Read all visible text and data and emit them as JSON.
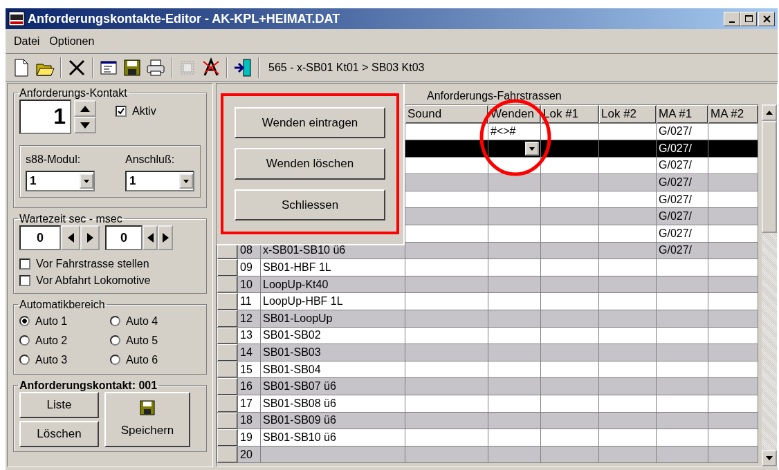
{
  "window": {
    "title": "Anforderungskontakte-Editor - AK-KPL+HEIMAT.DAT"
  },
  "menu": [
    "Datei",
    "Optionen"
  ],
  "toolbar": {
    "info": "565 - x-SB01 Kt01 > SB03 Kt03"
  },
  "contact": {
    "title": "Anforderungs-Kontakt",
    "value": "1",
    "aktiv": {
      "label": "Aktiv",
      "checked": true
    },
    "s88_label": "s88-Modul:",
    "s88_value": "1",
    "anschluss_label": "Anschluß:",
    "anschluss_value": "1"
  },
  "wartezeit": {
    "title": "Wartezeit  sec - msec",
    "sec": "0",
    "msec": "0"
  },
  "options": [
    {
      "label": "Vor Fahrstrasse stellen",
      "checked": false
    },
    {
      "label": "Vor Abfahrt Lokomotive",
      "checked": false
    }
  ],
  "automatik": {
    "title": "Automatikbereich",
    "radios": [
      {
        "label": "Auto 1",
        "selected": true
      },
      {
        "label": "Auto 2",
        "selected": false
      },
      {
        "label": "Auto 3",
        "selected": false
      },
      {
        "label": "Auto 4",
        "selected": false
      },
      {
        "label": "Auto 5",
        "selected": false
      },
      {
        "label": "Auto 6",
        "selected": false
      }
    ]
  },
  "footer_group": {
    "title": "Anforderungskontakt: 001",
    "buttons": [
      "Liste",
      "Löschen"
    ],
    "save_button": "Speichern"
  },
  "popup": {
    "buttons": [
      "Wenden  eintragen",
      "Wenden  löschen",
      "Schliessen"
    ]
  },
  "grid": {
    "title": "Anforderungs-Fahrstrassen",
    "columns": [
      "Sound",
      "Wenden",
      "Lok #1",
      "Lok #2",
      "MA #1",
      "MA #2"
    ],
    "rows": [
      {
        "wenden": "#<>#",
        "ma_1": "G/027/",
        "selected": false,
        "editing": false
      },
      {
        "ma_1": "G/027/",
        "selected": true,
        "editing": true
      },
      {
        "ma_1": "G/027/",
        "selected": false,
        "editing": false
      },
      {
        "ma_1": "G/027/",
        "selected": false,
        "editing": false
      },
      {
        "ma_1": "G/027/",
        "selected": false,
        "editing": false
      },
      {
        "ma_1": "G/027/",
        "selected": false,
        "editing": false
      },
      {
        "ma_1": "G/027/",
        "selected": false,
        "editing": false
      },
      {
        "number": "08",
        "name": "x-SB01-SB10 ü6",
        "ma_1": "G/027/",
        "selected": false,
        "editing": false
      },
      {
        "number": "09",
        "name": "SB01-HBF 1L",
        "selected": false,
        "editing": false
      },
      {
        "number": "10",
        "name": "LoopUp-Kt40",
        "selected": false,
        "editing": false
      },
      {
        "number": "11",
        "name": "LoopUp-HBF 1L",
        "selected": false,
        "editing": false
      },
      {
        "number": "12",
        "name": "SB01-LoopUp",
        "selected": false,
        "editing": false
      },
      {
        "number": "13",
        "name": "SB01-SB02",
        "selected": false,
        "editing": false
      },
      {
        "number": "14",
        "name": "SB01-SB03",
        "selected": false,
        "editing": false
      },
      {
        "number": "15",
        "name": "SB01-SB04",
        "selected": false,
        "editing": false
      },
      {
        "number": "16",
        "name": "SB01-SB07 ü6",
        "selected": false,
        "editing": false
      },
      {
        "number": "17",
        "name": "SB01-SB08 ü6",
        "selected": false,
        "editing": false
      },
      {
        "number": "18",
        "name": "SB01-SB09 ü6",
        "selected": false,
        "editing": false
      },
      {
        "number": "19",
        "name": "SB01-SB10 ü6",
        "selected": false,
        "editing": false
      },
      {
        "number": "20",
        "selected": false,
        "editing": false
      }
    ]
  }
}
